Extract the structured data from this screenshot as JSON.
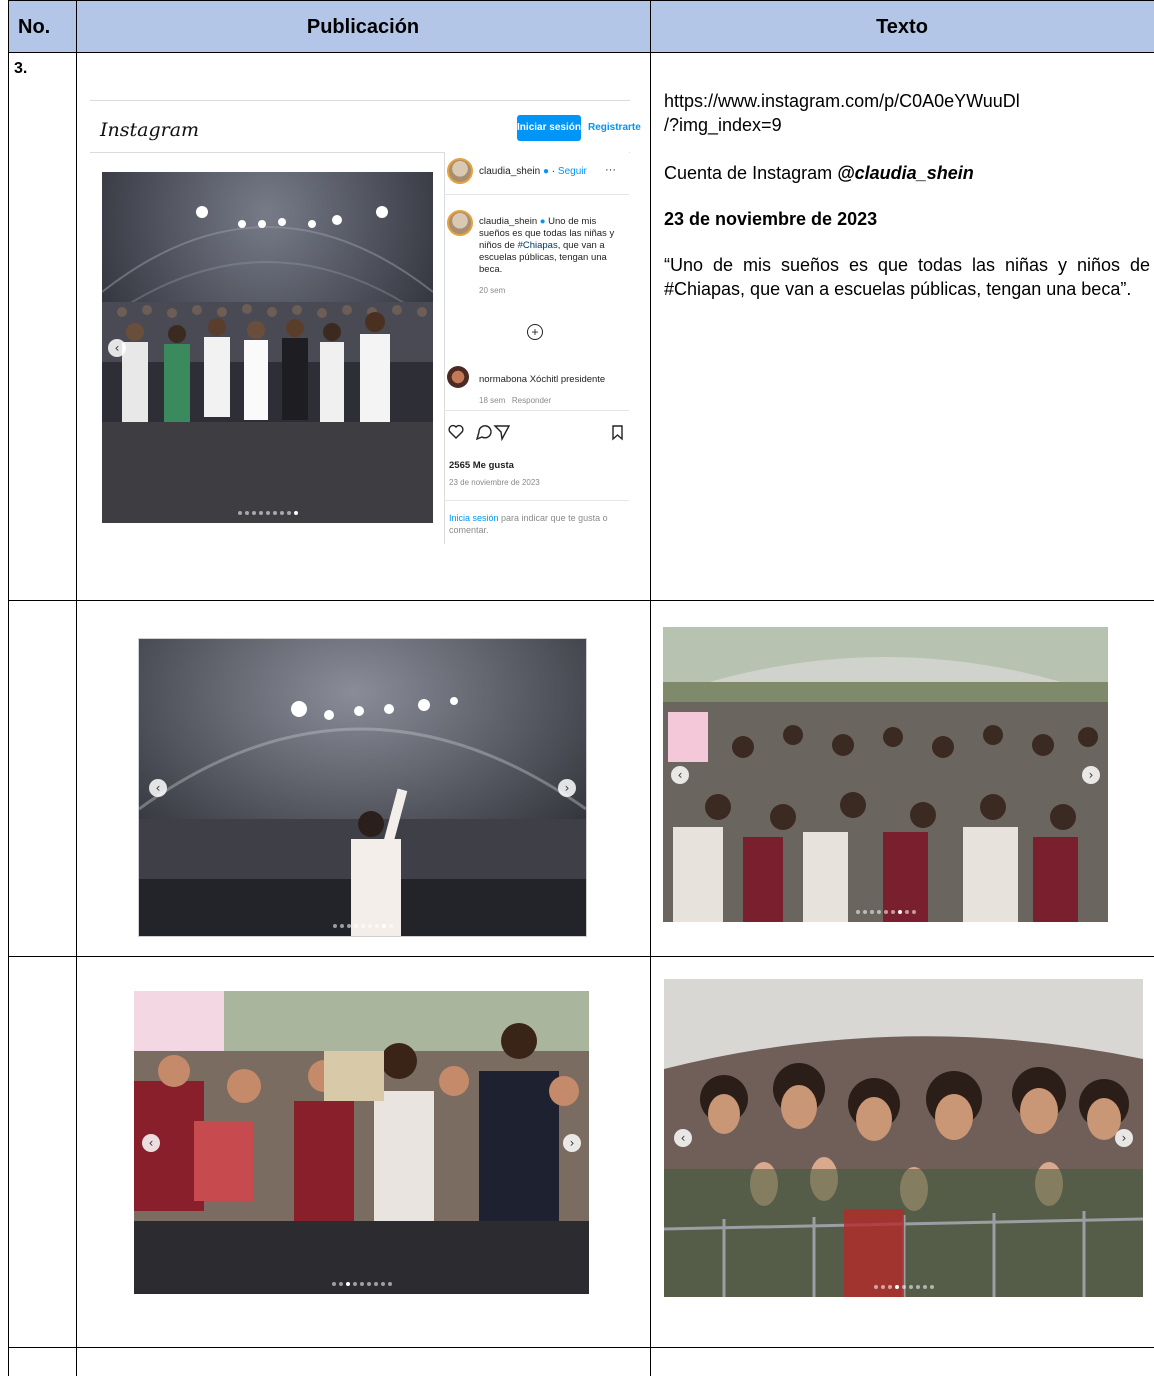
{
  "table": {
    "headers": [
      "No.",
      "Publicación",
      "Texto"
    ],
    "row_number": "3."
  },
  "instagram": {
    "logo": "Instagram",
    "login_label": "Iniciar sesión",
    "register_label": "Registrarte",
    "username": "claudia_shein",
    "follow_label": "Seguir",
    "more_label": "···",
    "caption": "Uno de mis sueños es que todas las niñas y niños de",
    "hashtag": "#Chiapas",
    "caption_rest": ", que van a escuelas públicas, tengan una beca.",
    "caption_age": "20 sem",
    "comment_user": "normabona",
    "comment_text": "Xóchitl presidente",
    "comment_age": "18 sem",
    "reply_label": "Responder",
    "likes": "2565 Me gusta",
    "post_date": "23 de noviembre de 2023",
    "login_link": "Inicia sesión",
    "login_prompt": " para indicar que te gusta o comentar."
  },
  "texto": {
    "url_line1": "https://www.instagram.com/p/C0A0eYWuuDl",
    "url_line2": "/?img_index=9",
    "account_prefix": "Cuenta de Instagram ",
    "account_handle": "@claudia_shein",
    "date": "23 de noviembre de 2023",
    "quote": "“Uno de mis sueños es que todas las niñas y niños de #Chiapas, que van a escuelas públicas, tengan una beca”."
  },
  "icons": [
    "heart-icon",
    "comment-icon",
    "share-icon",
    "bookmark-icon",
    "add-comment-icon",
    "prev-arrow-icon",
    "next-arrow-icon",
    "verified-icon"
  ],
  "colors": {
    "header_bg": "#b4c6e7",
    "ig_blue": "#0095f6"
  }
}
